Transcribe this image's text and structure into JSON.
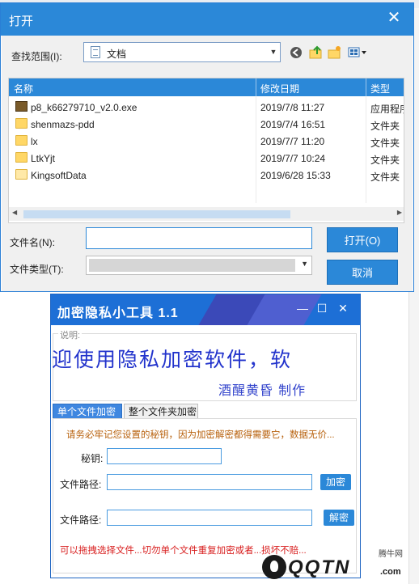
{
  "open_dialog": {
    "title": "打开",
    "look_in_label": "查找范围(I):",
    "look_in_value": "文档",
    "columns": [
      "名称",
      "修改日期",
      "类型"
    ],
    "files": [
      {
        "name": "p8_k66279710_v2.0.exe",
        "date": "2019/7/8 11:27",
        "type": "应用程序",
        "icon": "exe-icon"
      },
      {
        "name": "shenmazs-pdd",
        "date": "2019/7/4 16:51",
        "type": "文件夹",
        "icon": "folder-icon"
      },
      {
        "name": "lx",
        "date": "2019/7/7 11:20",
        "type": "文件夹",
        "icon": "folder-icon"
      },
      {
        "name": "LtkYjt",
        "date": "2019/7/7 10:24",
        "type": "文件夹",
        "icon": "folder-icon"
      },
      {
        "name": "KingsoftData",
        "date": "2019/6/28 15:33",
        "type": "文件夹",
        "icon": "folder-icon"
      }
    ],
    "filename_label": "文件名(N):",
    "filename_value": "",
    "filetype_label": "文件类型(T):",
    "filetype_value": "",
    "open_button": "打开(O)",
    "cancel_button": "取消",
    "accent_color": "#2b88d8"
  },
  "tool": {
    "title": "加密隐私小工具 1.1",
    "desc_label": "说明:",
    "desc_banner": "迎使用隐私加密软件，软",
    "desc_sign": "酒醒黄昏 制作",
    "tabs": [
      "单个文件加密",
      "整个文件夹加密"
    ],
    "warn_top": "请务必牢记您设置的秘钥，因为加密解密都得需要它，数据无价...",
    "key_label": "秘钥:",
    "key_value": "",
    "path_label_1": "文件路径:",
    "path_value_1": "",
    "encrypt_button": "加密",
    "path_label_2": "文件路径:",
    "path_value_2": "",
    "decrypt_button": "解密",
    "warn_bottom": "可以拖拽选择文件...切勿单个文件重复加密或者...损坏不赔...",
    "title_color": "#1d6fd6",
    "banner_color": "#2233cc"
  },
  "watermark": {
    "small": "腾牛网",
    "logo": "QQTN",
    "domain": ".com"
  }
}
